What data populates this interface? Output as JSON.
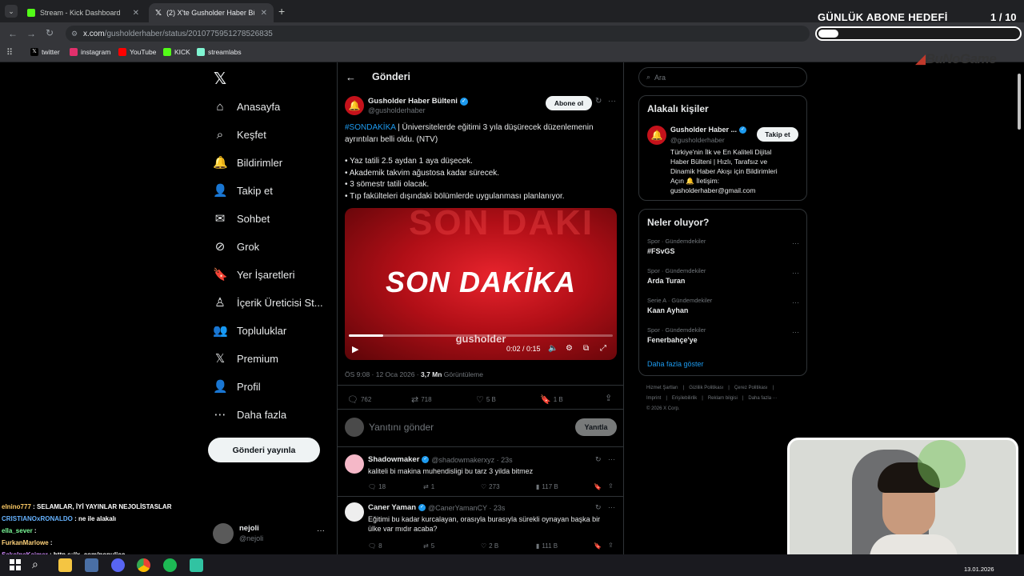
{
  "browser": {
    "tabs": [
      {
        "label": "Stream - Kick Dashboard",
        "active": false
      },
      {
        "label": "(2) X'te Gusholder Haber Bülten",
        "active": true
      }
    ],
    "url_domain": "x.com",
    "url_path": "/gusholderhaber/status/2010775951278526835",
    "bookmarks": [
      "twitter",
      "instagram",
      "YouTube",
      "KICK",
      "streamlabs"
    ]
  },
  "overlay": {
    "title": "GÜNLÜK ABONE HEDEFİ",
    "count": "1 / 10",
    "progress": 0.1,
    "brand": "BuNoGame"
  },
  "left_nav": {
    "items": [
      {
        "label": "Anasayfa",
        "icon": "home-icon"
      },
      {
        "label": "Keşfet",
        "icon": "search-icon"
      },
      {
        "label": "Bildirimler",
        "icon": "bell-icon"
      },
      {
        "label": "Takip et",
        "icon": "follow-icon"
      },
      {
        "label": "Sohbet",
        "icon": "mail-icon"
      },
      {
        "label": "Grok",
        "icon": "grok-icon"
      },
      {
        "label": "Yer İşaretleri",
        "icon": "bookmark-icon"
      },
      {
        "label": "İçerik Üreticisi St...",
        "icon": "creator-icon"
      },
      {
        "label": "Topluluklar",
        "icon": "communities-icon"
      },
      {
        "label": "Premium",
        "icon": "x-icon"
      },
      {
        "label": "Profil",
        "icon": "profile-icon"
      },
      {
        "label": "Daha fazla",
        "icon": "more-icon"
      }
    ],
    "post_button": "Gönderi yayınla",
    "account": {
      "name": "nejoli",
      "handle": "@nejoli"
    }
  },
  "post": {
    "header": "Gönderi",
    "author_name": "Gusholder Haber Bülteni",
    "author_handle": "@gusholderhaber",
    "subscribe_label": "Abone ol",
    "hashtag": "#SONDAKİKA",
    "text_line1": " | Üniversitelerde eğitimi 3 yıla düşürecek düzenlemenin",
    "text_line2": "ayrıntıları belli oldu. (NTV)",
    "bullets": [
      "• Yaz tatili 2.5 aydan 1 aya düşecek.",
      "• Akademik takvim ağustosa kadar sürecek.",
      "• 3 sömestr tatili olacak.",
      "• Tıp fakülteleri dışındaki bölümlerde uygulanması planlanıyor."
    ],
    "video_title": "SON DAKİKA",
    "video_bg_text": "SON DAKİ",
    "video_watermark": "gusholder",
    "video_time": "0:02 / 0:15",
    "video_progress": 0.13,
    "timestamp": "ÖS 9:08 · 12 Oca 2026 · ",
    "views": "3,7 Mn",
    "views_label": " Görüntüleme",
    "stats": {
      "replies": "762",
      "reposts": "718",
      "likes": "5 B",
      "bookmarks": "1 B"
    },
    "reply_placeholder": "Yanıtını gönder",
    "reply_button": "Yanıtla"
  },
  "replies": [
    {
      "name": "Shadowmaker",
      "handle": "@shadowmakerxyz · 23s",
      "text1": "kaliteli bi makina muhendisligi bu tarz 3 yilda bitmez",
      "text2": "",
      "replies": "18",
      "reposts": "1",
      "likes": "273",
      "views": "117 B"
    },
    {
      "name": "Caner Yaman",
      "handle": "@CanerYamanCY · 23s",
      "text1": "Eğitimi bu kadar kurcalayan, orasıyla burasıyla sürekli oynayan başka bir",
      "text2": "ülke var mıdır acaba?",
      "replies": "8",
      "reposts": "5",
      "likes": "2 B",
      "views": "111 B"
    }
  ],
  "right": {
    "search_placeholder": "Ara",
    "related_title": "Alakalı kişiler",
    "related_name": "Gusholder Haber ...",
    "related_handle": "@gusholderhaber",
    "follow_label": "Takip et",
    "related_bio": [
      "Türkiye'nin İlk ve En Kaliteli Dijital",
      "Haber Bülteni | Hızlı, Tarafsız ve",
      "Dinamik Haber Akışı için Bildirimleri",
      "Açın 🔔 İletişim:",
      "gusholderhaber@gmail.com"
    ],
    "trends_title": "Neler oluyor?",
    "trends": [
      {
        "meta": "Spor · Gündemdekiler",
        "name": "#FSvGS"
      },
      {
        "meta": "Spor · Gündemdekiler",
        "name": "Arda Turan"
      },
      {
        "meta": "Serie A · Gündemdekiler",
        "name": "Kaan Ayhan"
      },
      {
        "meta": "Spor · Gündemdekiler",
        "name": "Fenerbahçe'ye"
      }
    ],
    "show_more": "Daha fazla göster",
    "footer_row1": [
      "Hizmet Şartları",
      "|",
      "Gizlilik Politikası",
      "|",
      "Çerez Politikası",
      "|"
    ],
    "footer_row2": [
      "Imprint",
      "|",
      "Erişilebilirlik",
      "|",
      "Reklam bilgisi",
      "|",
      "Daha fazla ···"
    ],
    "footer_copy": "© 2026 X Corp."
  },
  "chat": [
    {
      "user": "elnino777",
      "msg": " : SELAMLAR, İYİ YAYINLAR NEJOLİSTASLAR",
      "color": "#ffcc66"
    },
    {
      "user": "CRISTIANOxRONALDO",
      "msg": " : ne ile alakalı",
      "color": "#66b3ff"
    },
    {
      "user": "ella_sever",
      "msg": " : ",
      "color": "#7cfc9a"
    },
    {
      "user": "FurkanMarlowe",
      "msg": " : ",
      "color": "#ffd27a"
    },
    {
      "user": "SakolpaKajmer",
      "msg": " : http s://x. com/populicc",
      "color": "#d38cff"
    }
  ],
  "taskbar": {
    "date": "13.01.2026"
  },
  "colors": {
    "accent": "#1d9bf0",
    "verified": "#1d9bf0",
    "video_red": "#c4121b",
    "background": "#000000",
    "border": "#2f3336"
  }
}
